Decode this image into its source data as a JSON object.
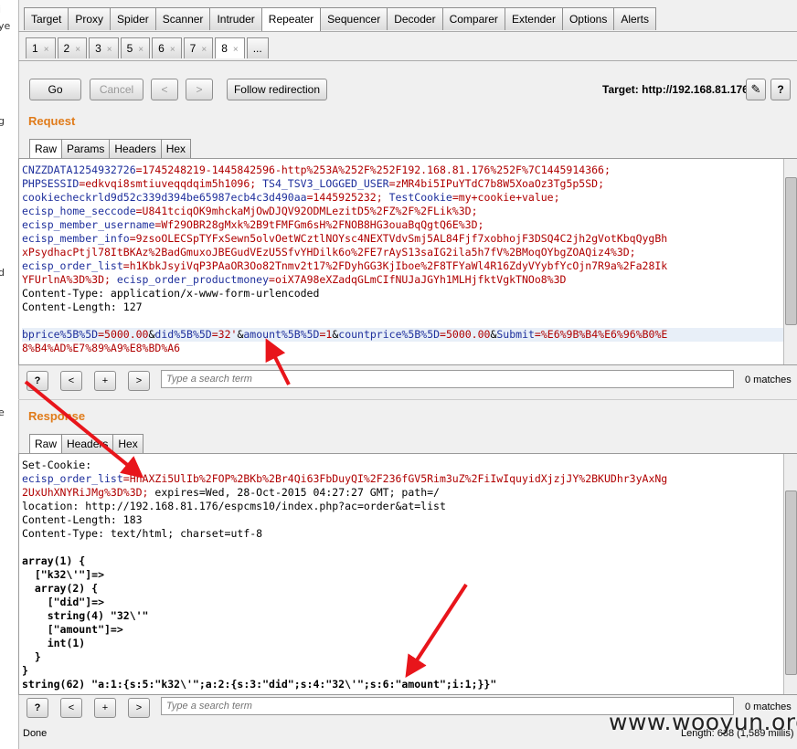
{
  "left_strip": [
    "i",
    "ye",
    "g",
    "d",
    "e"
  ],
  "main_tabs": [
    {
      "label": "Target"
    },
    {
      "label": "Proxy"
    },
    {
      "label": "Spider"
    },
    {
      "label": "Scanner"
    },
    {
      "label": "Intruder"
    },
    {
      "label": "Repeater"
    },
    {
      "label": "Sequencer"
    },
    {
      "label": "Decoder"
    },
    {
      "label": "Comparer"
    },
    {
      "label": "Extender"
    },
    {
      "label": "Options"
    },
    {
      "label": "Alerts"
    }
  ],
  "repeater_tabs": [
    {
      "label": "1",
      "close": "×"
    },
    {
      "label": "2",
      "close": "×"
    },
    {
      "label": "3",
      "close": "×"
    },
    {
      "label": "5",
      "close": "×"
    },
    {
      "label": "6",
      "close": "×"
    },
    {
      "label": "7",
      "close": "×"
    },
    {
      "label": "8",
      "close": "×"
    },
    {
      "label": "..."
    }
  ],
  "toolbar": {
    "go": "Go",
    "cancel": "Cancel",
    "back": "<",
    "forward": ">",
    "follow": "Follow redirection",
    "target": "Target: http://192.168.81.176",
    "edit_icon": "✎",
    "help_icon": "?"
  },
  "request": {
    "heading": "Request",
    "tabs": [
      {
        "label": "Raw"
      },
      {
        "label": "Params"
      },
      {
        "label": "Headers"
      },
      {
        "label": "Hex"
      }
    ],
    "lines": [
      [
        {
          "t": "CNZZDATA1254932726",
          "c": "k"
        },
        {
          "t": "=1745248219-1445842596-http%253A%252F%252F192.168.81.176%252F%7C1445914366;",
          "c": "v"
        }
      ],
      [
        {
          "t": "PHPSESSID",
          "c": "k"
        },
        {
          "t": "=edkvqi8smtiuveqqdqim5h1096;",
          "c": "v"
        },
        {
          "t": " TS4_TSV3_LOGGED_USER",
          "c": "k"
        },
        {
          "t": "=zMR4bi5IPuYTdC7b8W5XoaOz3Tg5p5SD;",
          "c": "v"
        }
      ],
      [
        {
          "t": "cookiecheckrld9d52c339d394be65987ecb4c3d490aa",
          "c": "k"
        },
        {
          "t": "=1445925232;",
          "c": "v"
        },
        {
          "t": " TestCookie",
          "c": "k"
        },
        {
          "t": "=my+cookie+value;",
          "c": "v"
        }
      ],
      [
        {
          "t": "ecisp_home_seccode",
          "c": "k"
        },
        {
          "t": "=U841tciqOK9mhckaMjOwDJQV92ODMLezitD5%2FZ%2F%2FLik%3D;",
          "c": "v"
        }
      ],
      [
        {
          "t": "ecisp_member_username",
          "c": "k"
        },
        {
          "t": "=Wf29OBR28gMxk%2B9tFMFGm6sH%2FNOB8HG3ouaBqQgtQ6E%3D;",
          "c": "v"
        }
      ],
      [
        {
          "t": "ecisp_member_info",
          "c": "k"
        },
        {
          "t": "=9zsoOLECSpTYFxSewn5olvOetWCztlNOYsc4NEXTVdvSmj5AL84Fjf7xobhojF3DSQ4C2jh2gVotKbqQygBh",
          "c": "v"
        }
      ],
      [
        {
          "t": "xPsydhacPtjl78ItBKAz%2BadGmuxoJBEGudVEzU5SfvYHDilk6o%2FE7rAyS13saIG2ila5h7fV%2BMoqOYbgZOAQiz4%3D;",
          "c": "v"
        }
      ],
      [
        {
          "t": "ecisp_order_list",
          "c": "k"
        },
        {
          "t": "=h1KbkJsyiVqP3PAaOR3Oo82Tnmv2t17%2FDyhGG3KjIboe%2F8TFYaWl4R16ZdyVYybfYcOjn7R9a%2Fa28Ik",
          "c": "v"
        }
      ],
      [
        {
          "t": "YFUrlnA%3D%3D;",
          "c": "v"
        },
        {
          "t": " ecisp_order_productmoney",
          "c": "k"
        },
        {
          "t": "=oiX7A98eXZadqGLmCIfNUJaJGYh1MLHjfktVgkTNOo8%3D",
          "c": "v"
        }
      ],
      [
        {
          "t": "Content-Type: application/x-www-form-urlencoded",
          "c": ""
        }
      ],
      [
        {
          "t": "Content-Length: 127",
          "c": ""
        }
      ],
      [
        {
          "t": "",
          "c": ""
        }
      ],
      [
        {
          "t": "bprice%5B%5D",
          "c": "k"
        },
        {
          "t": "=5000.00",
          "c": "v"
        },
        {
          "t": "&",
          "c": ""
        },
        {
          "t": "did%5B%5D",
          "c": "k"
        },
        {
          "t": "=32'",
          "c": "v"
        },
        {
          "t": "&",
          "c": ""
        },
        {
          "t": "amount%5B%5D",
          "c": "k"
        },
        {
          "t": "=1",
          "c": "v"
        },
        {
          "t": "&",
          "c": ""
        },
        {
          "t": "countprice%5B%5D",
          "c": "k"
        },
        {
          "t": "=5000.00",
          "c": "v"
        },
        {
          "t": "&",
          "c": ""
        },
        {
          "t": "Submit",
          "c": "k"
        },
        {
          "t": "=%E6%9B%B4%E6%96%B0%E",
          "c": "v"
        }
      ],
      [
        {
          "t": "8%B4%AD%E7%89%A9%E8%BD%A6",
          "c": "v"
        }
      ]
    ],
    "search_placeholder": "Type a search term",
    "matches": "0 matches"
  },
  "response": {
    "heading": "Response",
    "tabs": [
      {
        "label": "Raw"
      },
      {
        "label": "Headers"
      },
      {
        "label": "Hex"
      }
    ],
    "lines": [
      [
        {
          "t": "Set-Cookie:",
          "c": ""
        }
      ],
      [
        {
          "t": "ecisp_order_list",
          "c": "k"
        },
        {
          "t": "=HnAXZi5UlIb%2FOP%2BKb%2Br4Qi63FbDuyQI%2F236fGV5Rim3uZ%2FiIwIquyidXjzjJY%2BKUDhr3yAxNg",
          "c": "v"
        }
      ],
      [
        {
          "t": "2UxUhXNYRiJMg%3D%3D;",
          "c": "v"
        },
        {
          "t": " expires=Wed, 28-Oct-2015 04:27:27 GMT; path=/",
          "c": ""
        }
      ],
      [
        {
          "t": "location: http://192.168.81.176/espcms10/index.php?ac=order&at=list",
          "c": ""
        }
      ],
      [
        {
          "t": "Content-Length: 183",
          "c": ""
        }
      ],
      [
        {
          "t": "Content-Type: text/html; charset=utf-8",
          "c": ""
        }
      ],
      [
        {
          "t": "",
          "c": ""
        }
      ],
      [
        {
          "t": "array(1) {",
          "c": "b"
        }
      ],
      [
        {
          "t": "  [\"k32\\'\"]=>",
          "c": "b"
        }
      ],
      [
        {
          "t": "  array(2) {",
          "c": "b"
        }
      ],
      [
        {
          "t": "    [\"did\"]=>",
          "c": "b"
        }
      ],
      [
        {
          "t": "    string(4) \"32\\'\"",
          "c": "b"
        }
      ],
      [
        {
          "t": "    [\"amount\"]=>",
          "c": "b"
        }
      ],
      [
        {
          "t": "    int(1)",
          "c": "b"
        }
      ],
      [
        {
          "t": "  }",
          "c": "b"
        }
      ],
      [
        {
          "t": "}",
          "c": "b"
        }
      ],
      [
        {
          "t": "string(62) \"a:1:{s:5:\"k32\\'\";a:2:{s:3:\"did\";s:4:\"32\\'\";s:6:\"amount\";i:1;}}\"",
          "c": "b"
        }
      ]
    ],
    "search_placeholder": "Type a search term",
    "matches": "0 matches"
  },
  "search_buttons": {
    "help": "?",
    "prev": "<",
    "add": "+",
    "next": ">"
  },
  "status": {
    "left": "Done",
    "right": "Length: 638 (1,589 millis)"
  },
  "watermark": "www.wooyun.org",
  "colors": {
    "accent": "#e07b1a",
    "key": "#1e2f9c",
    "value": "#b00000",
    "arrow": "#e8151b"
  }
}
